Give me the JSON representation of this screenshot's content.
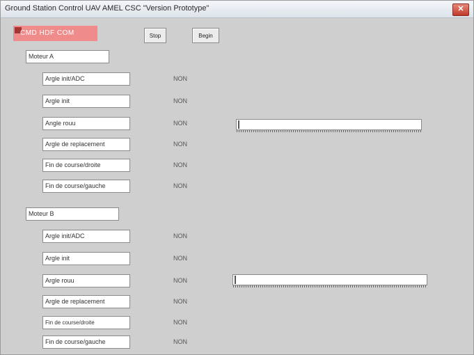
{
  "window": {
    "title": "Ground Station Control UAV AMEL CSC \"Version Prototype\"",
    "close_label": "✕"
  },
  "com": {
    "label": "CMD HDF COM"
  },
  "buttons": {
    "stop_label": "Stop",
    "begin_label": "Begin"
  },
  "motor_a": {
    "title": "Moteur A",
    "rows": [
      {
        "label": "Argle init/ADC",
        "value": "NON"
      },
      {
        "label": "Argle init",
        "value": "NON"
      },
      {
        "label": "Angle rouu",
        "value": "NON"
      },
      {
        "label": "Argle de replacement",
        "value": "NON"
      },
      {
        "label": "Fin de course/droite",
        "value": "NON"
      },
      {
        "label": "Fin de course/gauche",
        "value": "NON"
      }
    ],
    "slider_level": 0
  },
  "motor_b": {
    "title": "Moteur B",
    "rows": [
      {
        "label": "Argle init/ADC",
        "value": "NON"
      },
      {
        "label": "Argle init",
        "value": "NON"
      },
      {
        "label": "Argle rouu",
        "value": "NON"
      },
      {
        "label": "Argle de replacement",
        "value": "NON"
      },
      {
        "label": "Fin de course/droite",
        "value": "NON"
      },
      {
        "label": "Fin de course/gauche",
        "value": "NON"
      }
    ],
    "slider_level": 0
  }
}
